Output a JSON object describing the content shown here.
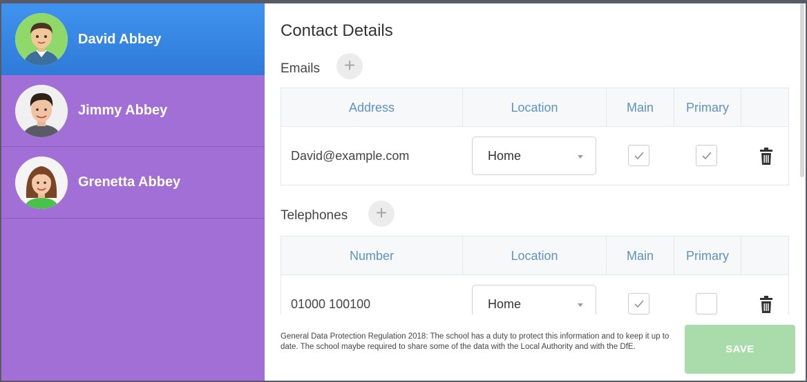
{
  "sidebar": {
    "contacts": [
      {
        "name": "David Abbey",
        "active": true
      },
      {
        "name": "Jimmy Abbey",
        "active": false
      },
      {
        "name": "Grenetta Abbey",
        "active": false
      }
    ]
  },
  "main": {
    "title": "Contact Details",
    "emails": {
      "label": "Emails",
      "add_symbol": "+",
      "columns": [
        "Address",
        "Location",
        "Main",
        "Primary"
      ],
      "rows": [
        {
          "address": "David@example.com",
          "location": "Home",
          "main": true,
          "primary": true
        }
      ]
    },
    "telephones": {
      "label": "Telephones",
      "add_symbol": "+",
      "columns": [
        "Number",
        "Location",
        "Main",
        "Primary"
      ],
      "rows": [
        {
          "number": "01000 100100",
          "location": "Home",
          "main": true,
          "primary": false
        }
      ]
    }
  },
  "footer": {
    "notice": "General Data Protection Regulation 2018: The school has a duty to protect this information and to keep it up to date. The school maybe required to share some of the data with the Local Authority and with the DfE.",
    "save_label": "SAVE"
  },
  "colors": {
    "sidebar_bg": "#a16fd6",
    "active_bg": "#3a8ae6",
    "header_text": "#5d92c2",
    "save_bg": "#a9dcaa"
  },
  "icons": {
    "add": "plus-icon",
    "delete": "trash-icon",
    "check": "check-icon",
    "dropdown": "chevron-down-icon"
  }
}
